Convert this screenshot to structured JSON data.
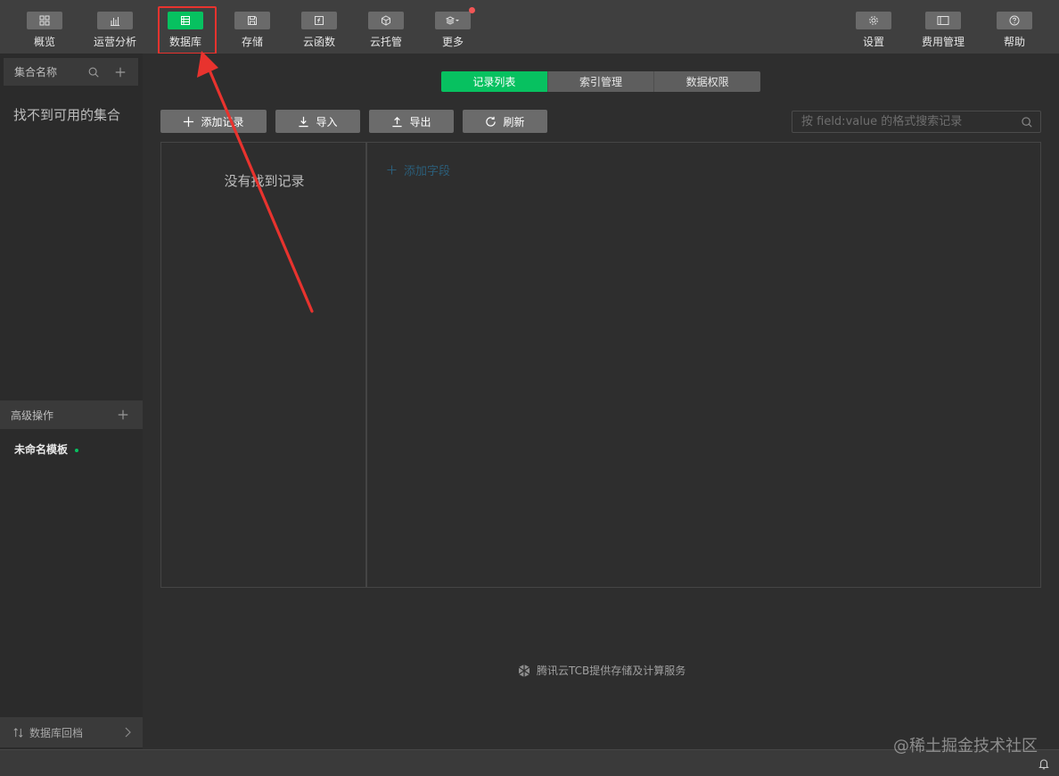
{
  "toolbar": {
    "items": [
      {
        "label": "概览",
        "icon": "grid-icon"
      },
      {
        "label": "运营分析",
        "icon": "bar-chart-icon"
      },
      {
        "label": "数据库",
        "icon": "database-icon",
        "active": true
      },
      {
        "label": "存储",
        "icon": "save-icon"
      },
      {
        "label": "云函数",
        "icon": "function-icon"
      },
      {
        "label": "云托管",
        "icon": "box-icon"
      },
      {
        "label": "更多",
        "icon": "layers-icon"
      },
      {
        "label": "设置",
        "icon": "gear-icon"
      },
      {
        "label": "费用管理",
        "icon": "billing-icon"
      },
      {
        "label": "帮助",
        "icon": "help-icon"
      }
    ]
  },
  "sidebar": {
    "collection_header": "集合名称",
    "empty_collections": "找不到可用的集合",
    "advanced_header": "高级操作",
    "template_name": "未命名模板",
    "rollback_label": "数据库回档"
  },
  "main": {
    "tabs": [
      {
        "label": "记录列表",
        "active": true
      },
      {
        "label": "索引管理",
        "active": false
      },
      {
        "label": "数据权限",
        "active": false
      }
    ],
    "actions": {
      "add_record": "添加记录",
      "import": "导入",
      "export": "导出",
      "refresh": "刷新"
    },
    "search_placeholder": "按 field:value 的格式搜索记录",
    "empty_records": "没有找到记录",
    "add_field": "添加字段",
    "footer_note": "腾讯云TCB提供存储及计算服务"
  },
  "watermark": "@稀土掘金技术社区",
  "colors": {
    "accent": "#07c160",
    "annotation": "#e8332e",
    "notification_dot": "#f25656"
  }
}
